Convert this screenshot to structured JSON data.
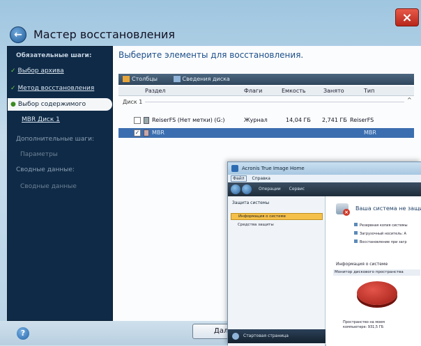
{
  "window": {
    "title": "Мастер восстановления",
    "close_glyph": "×"
  },
  "sidebar": {
    "required_heading": "Обязательные шаги:",
    "items": [
      {
        "label": "Выбор архива",
        "state": "done"
      },
      {
        "label": "Метод восстановления",
        "state": "done"
      },
      {
        "label": "Выбор содержимого",
        "state": "active"
      },
      {
        "label": "MBR Диск 1",
        "state": "link"
      }
    ],
    "additional_heading": "Дополнительные шаги:",
    "additional_items": [
      "Параметры"
    ],
    "summary_heading": "Сводные данные:",
    "summary_items": [
      "Сводные данные"
    ]
  },
  "main": {
    "heading": "Выберите элементы для восстановления.",
    "toolbar": {
      "columns": "Столбцы",
      "disk_props": "Сведения диска"
    },
    "columns": [
      "Раздел",
      "Флаги",
      "Емкость",
      "Занято",
      "Тип"
    ],
    "disk_label": "Диск 1",
    "rows": [
      {
        "name": "ReiserFS (Нет метки) (G:)",
        "flags": "Журнал",
        "capacity": "14,04 ГБ",
        "used": "2,741 ГБ",
        "type": "ReiserFS",
        "checked": false,
        "selected": false
      },
      {
        "name": "MBR",
        "flags": "",
        "capacity": "",
        "used": "",
        "type": "MBR",
        "checked": true,
        "selected": true
      }
    ]
  },
  "footer": {
    "help": "?",
    "next_label": "Дал"
  },
  "overlay": {
    "title": "Acronis True Image Home",
    "menu": [
      "Файл",
      "Справка"
    ],
    "toolbar": [
      "Операции",
      "Сервис"
    ],
    "left_section": "Защита системы",
    "left_items": [
      "Информация о системе",
      "Средства защиты"
    ],
    "start_page": "Стартовая страница",
    "headline": "Ваша система не защи",
    "lines": [
      "Резервная копия системы",
      "Загрузочный носитель: А",
      "Восстановление при загр"
    ],
    "info_label": "Информация о системе",
    "monitor_label": "Монитор дискового пространства",
    "space_line1": "Пространство на моем",
    "space_line2": "компьютере: 931,5 ГБ"
  }
}
